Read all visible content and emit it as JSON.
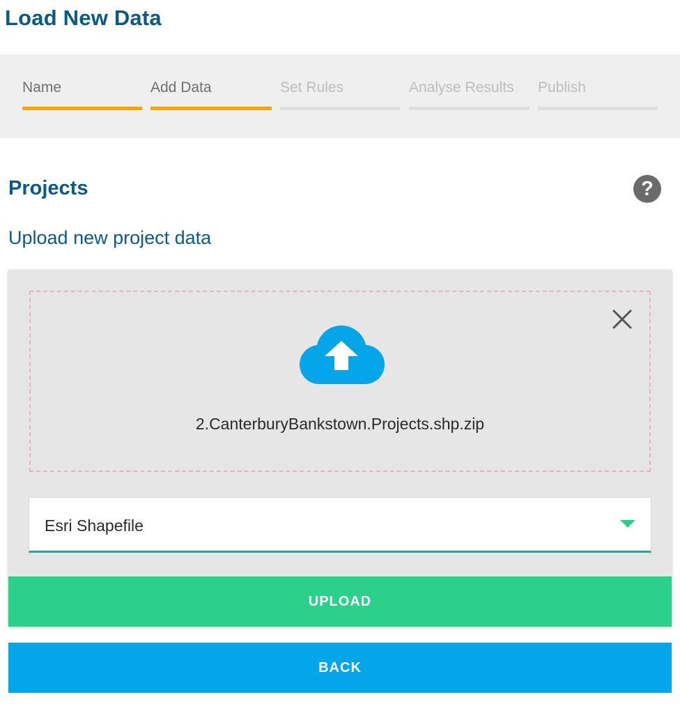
{
  "header": {
    "title": "Load New Data"
  },
  "steps": [
    {
      "label": "Name",
      "state": "done"
    },
    {
      "label": "Add Data",
      "state": "current"
    },
    {
      "label": "Set Rules",
      "state": "pending"
    },
    {
      "label": "Analyse Results",
      "state": "pending"
    },
    {
      "label": "Publish",
      "state": "pending"
    }
  ],
  "section": {
    "title": "Projects",
    "help_icon": "question-circle-icon",
    "help_glyph": "?",
    "subtitle": "Upload new project data"
  },
  "upload": {
    "icon": "cloud-upload-icon",
    "file_name": "2.CanterburyBankstown.Projects.shp.zip",
    "close_icon": "close-icon",
    "format_selected": "Esri Shapefile",
    "upload_label": "UPLOAD",
    "back_label": "BACK"
  },
  "colors": {
    "title": "#0a5a86",
    "step_active": "#f7a400",
    "step_inactive": "#dedede",
    "upload_button": "#2bd08a",
    "back_button": "#04a5e9",
    "cloud_icon": "#04a5e9",
    "select_underline": "#26a69a"
  }
}
